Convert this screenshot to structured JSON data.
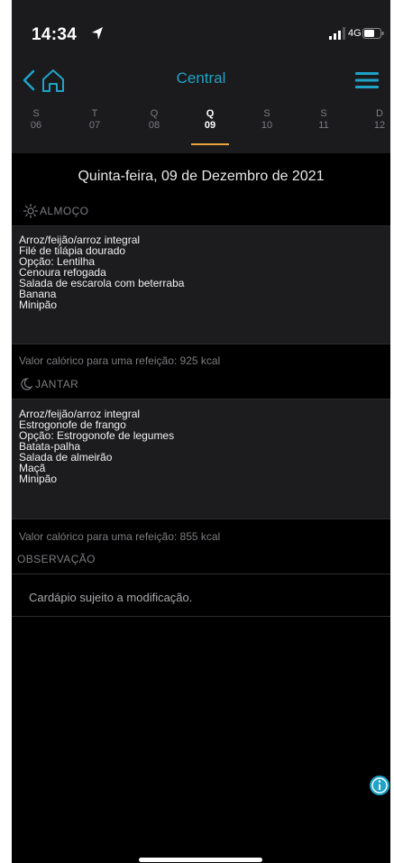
{
  "status": {
    "time": "14:34",
    "network": "4G"
  },
  "nav": {
    "title": "Central"
  },
  "days": [
    {
      "letter": "S",
      "num": "06"
    },
    {
      "letter": "T",
      "num": "07"
    },
    {
      "letter": "Q",
      "num": "08"
    },
    {
      "letter": "Q",
      "num": "09",
      "selected": true
    },
    {
      "letter": "S",
      "num": "10"
    },
    {
      "letter": "S",
      "num": "11"
    },
    {
      "letter": "D",
      "num": "12"
    }
  ],
  "date": "Quinta-feira, 09 de Dezembro de 2021",
  "lunch": {
    "header": "ALMOÇO",
    "items": [
      "Arroz/feijão/arroz integral",
      "Filé de tilápia dourado",
      "Opção: Lentilha",
      "Cenoura refogada",
      "Salada de escarola com beterraba",
      "Banana",
      "Minipão"
    ],
    "calories": "Valor calórico para uma refeição: 925 kcal"
  },
  "dinner": {
    "header": "JANTAR",
    "items": [
      "Arroz/feijão/arroz integral",
      "Estrogonofe de frango",
      "Opção: Estrogonofe de legumes",
      "Batata-palha",
      "Salada de almeirão",
      "Maçã",
      "Minipão"
    ],
    "calories": "Valor calórico para uma refeição: 855 kcal"
  },
  "observation": {
    "header": "OBSERVAÇÃO",
    "text": "Cardápio sujeito a modificação."
  },
  "colors": {
    "accent": "#1fa3c7",
    "selected_underline": "#e8a33c"
  }
}
